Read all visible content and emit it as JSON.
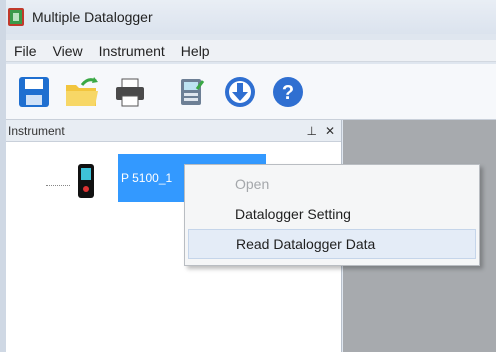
{
  "window": {
    "title": "Multiple Datalogger"
  },
  "menubar": {
    "items": [
      "File",
      "View",
      "Instrument",
      "Help"
    ]
  },
  "toolbar": {
    "buttons": [
      {
        "name": "save-icon"
      },
      {
        "name": "open-folder-icon"
      },
      {
        "name": "print-icon"
      },
      {
        "name": "settings-icon"
      },
      {
        "name": "download-icon"
      },
      {
        "name": "help-icon"
      }
    ]
  },
  "panel": {
    "title": "Instrument",
    "pin_glyph": "⊥",
    "close_glyph": "✕"
  },
  "tree": {
    "node_label": "P 5100_1"
  },
  "context_menu": {
    "items": [
      {
        "label": "Open",
        "state": "disabled"
      },
      {
        "label": "Datalogger Setting",
        "state": "normal"
      },
      {
        "label": "Read Datalogger Data",
        "state": "hover"
      }
    ]
  },
  "colors": {
    "selection": "#3399ff",
    "workspace": "#a7aaae",
    "accent_blue": "#2f6fd1"
  }
}
